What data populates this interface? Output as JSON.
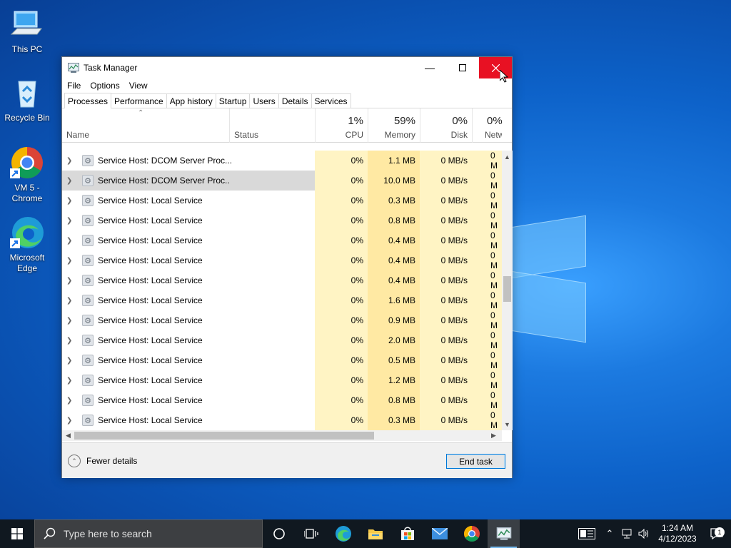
{
  "desktop": {
    "icons": [
      {
        "label": "This PC",
        "icon": "computer-icon"
      },
      {
        "label": "Recycle Bin",
        "icon": "recycle-bin-icon"
      },
      {
        "label": "VM 5 - Chrome",
        "icon": "chrome-icon"
      },
      {
        "label": "Microsoft Edge",
        "icon": "edge-icon"
      }
    ]
  },
  "window": {
    "title": "Task Manager",
    "menu": [
      "File",
      "Options",
      "View"
    ],
    "tabs": [
      "Processes",
      "Performance",
      "App history",
      "Startup",
      "Users",
      "Details",
      "Services"
    ],
    "active_tab": "Processes",
    "columns": {
      "name": "Name",
      "status": "Status",
      "cpu": {
        "pct": "1%",
        "label": "CPU"
      },
      "memory": {
        "pct": "59%",
        "label": "Memory"
      },
      "disk": {
        "pct": "0%",
        "label": "Disk"
      },
      "network": {
        "pct": "0%",
        "label": "Network"
      }
    },
    "rows": [
      {
        "name": "Service Host: DCOM Server Proc...",
        "status": "",
        "cpu": "0%",
        "memory": "1.1 MB",
        "disk": "0 MB/s",
        "network": "0 M"
      },
      {
        "name": "Service Host: DCOM Server Proc...",
        "status": "",
        "cpu": "0%",
        "memory": "10.0 MB",
        "disk": "0 MB/s",
        "network": "0 M",
        "selected": true
      },
      {
        "name": "Service Host: Local Service",
        "status": "",
        "cpu": "0%",
        "memory": "0.3 MB",
        "disk": "0 MB/s",
        "network": "0 M"
      },
      {
        "name": "Service Host: Local Service",
        "status": "",
        "cpu": "0%",
        "memory": "0.8 MB",
        "disk": "0 MB/s",
        "network": "0 M"
      },
      {
        "name": "Service Host: Local Service",
        "status": "",
        "cpu": "0%",
        "memory": "0.4 MB",
        "disk": "0 MB/s",
        "network": "0 M"
      },
      {
        "name": "Service Host: Local Service",
        "status": "",
        "cpu": "0%",
        "memory": "0.4 MB",
        "disk": "0 MB/s",
        "network": "0 M"
      },
      {
        "name": "Service Host: Local Service",
        "status": "",
        "cpu": "0%",
        "memory": "0.4 MB",
        "disk": "0 MB/s",
        "network": "0 M"
      },
      {
        "name": "Service Host: Local Service",
        "status": "",
        "cpu": "0%",
        "memory": "1.6 MB",
        "disk": "0 MB/s",
        "network": "0 M"
      },
      {
        "name": "Service Host: Local Service",
        "status": "",
        "cpu": "0%",
        "memory": "0.9 MB",
        "disk": "0 MB/s",
        "network": "0 M"
      },
      {
        "name": "Service Host: Local Service",
        "status": "",
        "cpu": "0%",
        "memory": "2.0 MB",
        "disk": "0 MB/s",
        "network": "0 M"
      },
      {
        "name": "Service Host: Local Service",
        "status": "",
        "cpu": "0%",
        "memory": "0.5 MB",
        "disk": "0 MB/s",
        "network": "0 M"
      },
      {
        "name": "Service Host: Local Service",
        "status": "",
        "cpu": "0%",
        "memory": "1.2 MB",
        "disk": "0 MB/s",
        "network": "0 M"
      },
      {
        "name": "Service Host: Local Service",
        "status": "",
        "cpu": "0%",
        "memory": "0.8 MB",
        "disk": "0 MB/s",
        "network": "0 M"
      },
      {
        "name": "Service Host: Local Service",
        "status": "",
        "cpu": "0%",
        "memory": "0.3 MB",
        "disk": "0 MB/s",
        "network": "0 M"
      }
    ],
    "footer": {
      "fewer_details": "Fewer details",
      "end_task": "End task"
    }
  },
  "taskbar": {
    "search_placeholder": "Type here to search",
    "apps": [
      "cortana-icon",
      "task-view-icon",
      "edge-icon",
      "file-explorer-icon",
      "store-icon",
      "mail-icon",
      "chrome-icon",
      "task-manager-icon"
    ],
    "clock": {
      "time": "1:24 AM",
      "date": "4/12/2023"
    },
    "notifications": "1"
  },
  "colors": {
    "close_red": "#e81123",
    "cpu_col": "#fff4c4",
    "mem_col": "#ffe9a3",
    "accent": "#0078d7"
  }
}
